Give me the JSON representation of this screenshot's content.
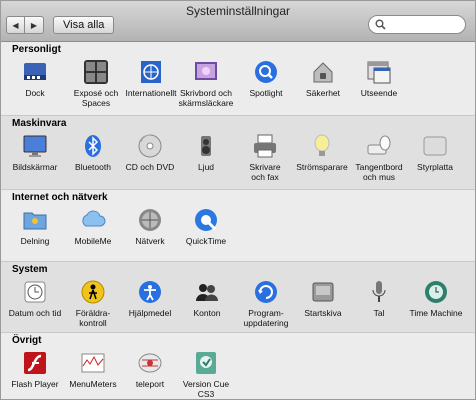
{
  "window": {
    "title": "Systeminställningar"
  },
  "toolbar": {
    "back_glyph": "◀",
    "forward_glyph": "▶",
    "show_all_label": "Visa alla",
    "search_placeholder": "",
    "search_value": ""
  },
  "sections": {
    "personal": {
      "title": "Personligt",
      "items": [
        {
          "label": "Dock",
          "icon": "dock-icon"
        },
        {
          "label": "Exposé och\nSpaces",
          "icon": "expose-spaces-icon"
        },
        {
          "label": "Internationellt",
          "icon": "international-icon"
        },
        {
          "label": "Skrivbord och\nskärmsläckare",
          "icon": "desktop-screensaver-icon"
        },
        {
          "label": "Spotlight",
          "icon": "spotlight-icon"
        },
        {
          "label": "Säkerhet",
          "icon": "security-icon"
        },
        {
          "label": "Utseende",
          "icon": "appearance-icon"
        }
      ]
    },
    "hardware": {
      "title": "Maskinvara",
      "items": [
        {
          "label": "Bildskärmar",
          "icon": "displays-icon"
        },
        {
          "label": "Bluetooth",
          "icon": "bluetooth-icon"
        },
        {
          "label": "CD och DVD",
          "icon": "cd-dvd-icon"
        },
        {
          "label": "Ljud",
          "icon": "sound-icon"
        },
        {
          "label": "Skrivare\noch fax",
          "icon": "printer-fax-icon"
        },
        {
          "label": "Strömsparare",
          "icon": "energy-saver-icon"
        },
        {
          "label": "Tangentbord\noch mus",
          "icon": "keyboard-mouse-icon"
        },
        {
          "label": "Styrplatta",
          "icon": "trackpad-icon"
        }
      ]
    },
    "internet": {
      "title": "Internet och nätverk",
      "items": [
        {
          "label": "Delning",
          "icon": "sharing-icon"
        },
        {
          "label": "MobileMe",
          "icon": "mobileme-icon"
        },
        {
          "label": "Nätverk",
          "icon": "network-icon"
        },
        {
          "label": "QuickTime",
          "icon": "quicktime-icon"
        }
      ]
    },
    "system": {
      "title": "System",
      "items": [
        {
          "label": "Datum och tid",
          "icon": "date-time-icon"
        },
        {
          "label": "Föräldra-\nkontroll",
          "icon": "parental-controls-icon"
        },
        {
          "label": "Hjälpmedel",
          "icon": "universal-access-icon"
        },
        {
          "label": "Konton",
          "icon": "accounts-icon"
        },
        {
          "label": "Program-\nuppdatering",
          "icon": "software-update-icon"
        },
        {
          "label": "Startskiva",
          "icon": "startup-disk-icon"
        },
        {
          "label": "Tal",
          "icon": "speech-icon"
        },
        {
          "label": "Time Machine",
          "icon": "time-machine-icon"
        }
      ]
    },
    "other": {
      "title": "Övrigt",
      "items": [
        {
          "label": "Flash Player",
          "icon": "flash-player-icon"
        },
        {
          "label": "MenuMeters",
          "icon": "menumeters-icon"
        },
        {
          "label": "teleport",
          "icon": "teleport-icon"
        },
        {
          "label": "Version Cue\nCS3",
          "icon": "version-cue-icon"
        }
      ]
    }
  }
}
